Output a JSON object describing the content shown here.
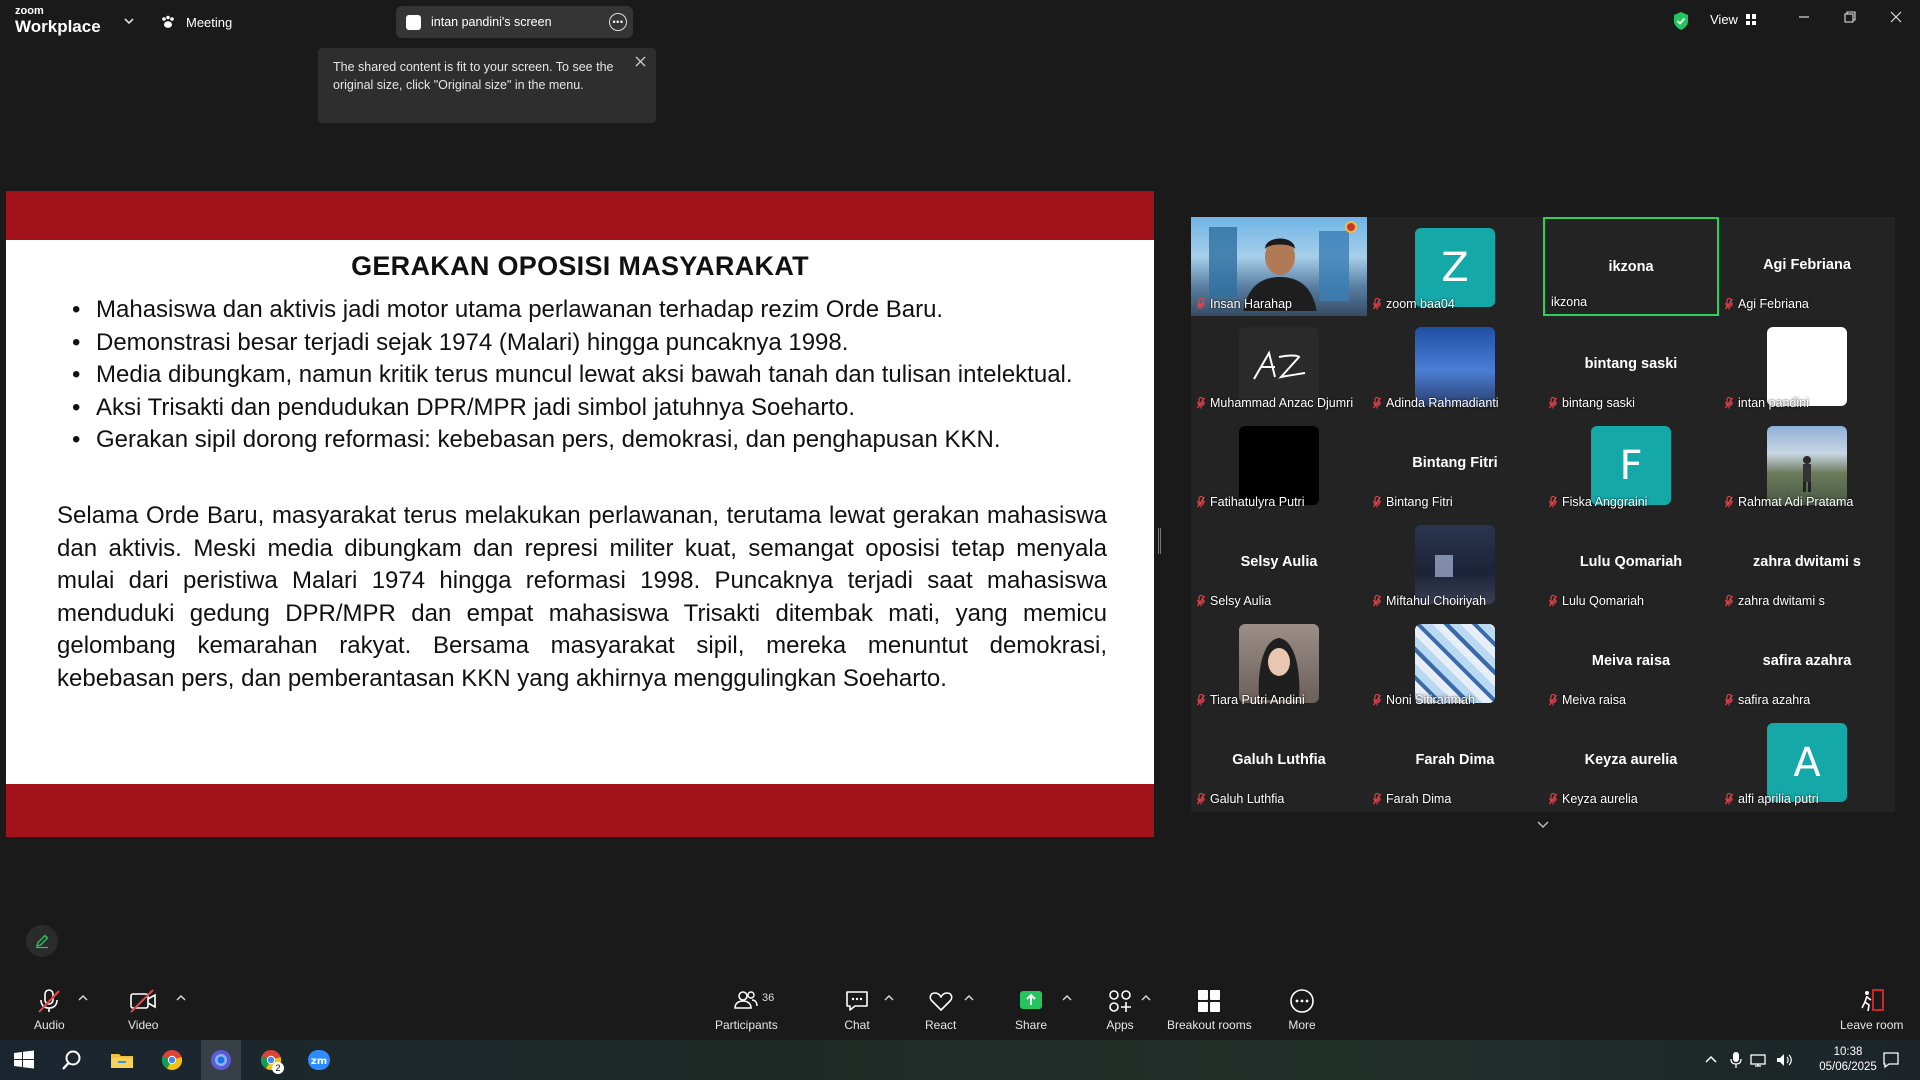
{
  "app": {
    "logo_top": "zoom",
    "logo_bottom": "Workplace"
  },
  "header": {
    "meeting_label": "Meeting",
    "share_title": "intan pandini's screen",
    "view_label": "View"
  },
  "tooltip": {
    "text": "The shared content is fit to your screen. To see the original size, click \"Original size\" in the menu."
  },
  "slide": {
    "title": "GERAKAN OPOSISI MASYARAKAT",
    "bullets": [
      "Mahasiswa dan aktivis jadi motor utama perlawanan terhadap rezim Orde Baru.",
      "Demonstrasi besar terjadi sejak 1974 (Malari) hingga puncaknya 1998.",
      "Media dibungkam, namun kritik terus muncul lewat aksi bawah tanah dan tulisan intelektual.",
      "Aksi Trisakti dan pendudukan DPR/MPR jadi simbol jatuhnya Soeharto.",
      "Gerakan sipil dorong reformasi: kebebasan pers, demokrasi, dan penghapusan KKN."
    ],
    "paragraph": "Selama Orde Baru, masyarakat terus melakukan perlawanan, terutama lewat gerakan mahasiswa dan aktivis. Meski media dibungkam dan represi militer kuat, semangat oposisi tetap menyala mulai dari peristiwa Malari 1974 hingga reformasi 1998. Puncaknya terjadi saat mahasiswa menduduki gedung DPR/MPR dan empat mahasiswa Trisakti ditembak mati, yang memicu gelombang kemarahan rakyat. Bersama masyarakat sipil, mereka menuntut demokrasi, kebebasan pers, dan pemberantasan KKN yang akhirnya menggulingkan Soeharto."
  },
  "participants_tiles": [
    {
      "label": "Insan Harahap",
      "display": "",
      "avatar": "photo-man",
      "muted": true,
      "active": false
    },
    {
      "label": "zoom baa04",
      "display": "",
      "avatar": "Z",
      "avatar_color": "#14a8a8",
      "muted": true,
      "active": false
    },
    {
      "label": "ikzona",
      "display": "ikzona",
      "avatar": "",
      "muted": false,
      "active": true
    },
    {
      "label": "Agi Febriana",
      "display": "Agi Febriana",
      "avatar": "",
      "muted": true,
      "active": false
    },
    {
      "label": "Muhammad Anzac Djumri",
      "display": "",
      "avatar": "signature",
      "muted": true,
      "active": false
    },
    {
      "label": "Adinda Rahmadianti",
      "display": "",
      "avatar": "photo-sky",
      "muted": true,
      "active": false
    },
    {
      "label": "bintang saski",
      "display": "bintang saski",
      "avatar": "",
      "muted": true,
      "active": false
    },
    {
      "label": "intan pandini",
      "display": "",
      "avatar": "white",
      "muted": true,
      "active": false
    },
    {
      "label": "Fatihatulyra Putri",
      "display": "",
      "avatar": "black",
      "muted": true,
      "active": false
    },
    {
      "label": "Bintang Fitri",
      "display": "Bintang Fitri",
      "avatar": "",
      "muted": true,
      "active": false
    },
    {
      "label": "Fiska Anggraini",
      "display": "",
      "avatar": "F",
      "avatar_color": "#14a8a8",
      "muted": true,
      "active": false
    },
    {
      "label": "Rahmat Adi Pratama",
      "display": "",
      "avatar": "photo-field",
      "muted": true,
      "active": false
    },
    {
      "label": "Selsy Aulia",
      "display": "Selsy Aulia",
      "avatar": "",
      "muted": true,
      "active": false
    },
    {
      "label": "Miftahul Choiriyah",
      "display": "",
      "avatar": "photo-dark",
      "muted": true,
      "active": false
    },
    {
      "label": "Lulu  Qomariah",
      "display": "Lulu  Qomariah",
      "avatar": "",
      "muted": true,
      "active": false
    },
    {
      "label": "zahra dwitami s",
      "display": "zahra dwitami s",
      "avatar": "",
      "muted": true,
      "active": false
    },
    {
      "label": "Tiara Putri Andini",
      "display": "",
      "avatar": "photo-girl",
      "muted": true,
      "active": false
    },
    {
      "label": "Noni Sitirahmah",
      "display": "",
      "avatar": "photo-pattern",
      "muted": true,
      "active": false
    },
    {
      "label": "Meiva raisa",
      "display": "Meiva raisa",
      "avatar": "",
      "muted": true,
      "active": false
    },
    {
      "label": "safira azahra",
      "display": "safira azahra",
      "avatar": "",
      "muted": true,
      "active": false
    },
    {
      "label": "Galuh Luthfia",
      "display": "Galuh Luthfia",
      "avatar": "",
      "muted": true,
      "active": false
    },
    {
      "label": "Farah Dima",
      "display": "Farah Dima",
      "avatar": "",
      "muted": true,
      "active": false
    },
    {
      "label": "Keyza aurelia",
      "display": "Keyza aurelia",
      "avatar": "",
      "muted": true,
      "active": false
    },
    {
      "label": "alfi aprilia putri",
      "display": "",
      "avatar": "A",
      "avatar_color": "#14a8a8",
      "muted": true,
      "active": false
    }
  ],
  "toolbar": {
    "audio": "Audio",
    "video": "Video",
    "participants": "Participants",
    "participants_count": "36",
    "chat": "Chat",
    "react": "React",
    "share": "Share",
    "apps": "Apps",
    "breakout": "Breakout rooms",
    "more": "More",
    "leave": "Leave room"
  },
  "taskbar": {
    "time": "10:38",
    "date": "05/06/2025",
    "chrome_badge": "2"
  },
  "colors": {
    "slide_band": "#a3111a",
    "active_speaker": "#2bd15b",
    "avatar_teal": "#14a8a8",
    "share_green": "#22c55e",
    "muted_red": "#e8434a",
    "leave_red": "#e02828"
  }
}
